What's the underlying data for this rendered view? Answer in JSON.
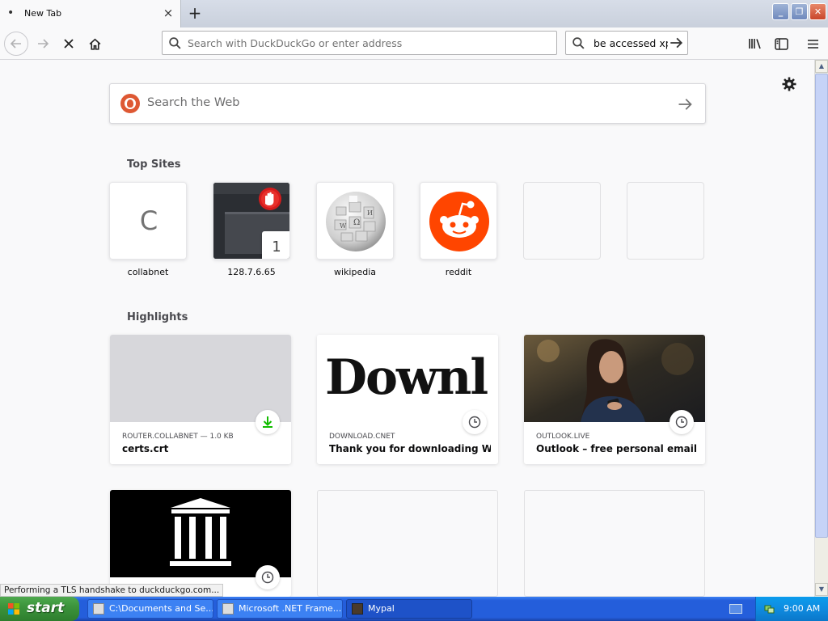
{
  "tab": {
    "title": "New Tab",
    "close_glyph": "×",
    "new_glyph": "+"
  },
  "window_controls": {
    "minimize": "_",
    "maximize": "❐",
    "close": "✕"
  },
  "navbar": {
    "url_placeholder": "Search with DuckDuckGo or enter address",
    "search_value": "be accessed xp"
  },
  "web_search": {
    "placeholder": "Search the Web"
  },
  "top_sites": {
    "title": "Top Sites",
    "items": [
      {
        "label": "collabnet",
        "letter": "C"
      },
      {
        "label": "128.7.6.65",
        "badge": "1"
      },
      {
        "label": "wikipedia"
      },
      {
        "label": "reddit"
      },
      {
        "label": ""
      },
      {
        "label": ""
      }
    ]
  },
  "highlights": {
    "title": "Highlights",
    "cards": [
      {
        "host": "ROUTER.COLLABNET — 1.0 KB",
        "title": "certs.crt",
        "badge": "download-icon"
      },
      {
        "host": "DOWNLOAD.CNET",
        "title": "Thank you for downloading Win...",
        "thumb_text": "Downl",
        "badge": "clock-icon"
      },
      {
        "host": "OUTLOOK.LIVE",
        "title": "Outlook – free personal email an...",
        "badge": "clock-icon"
      },
      {
        "host": "",
        "title": "",
        "badge": "clock-icon"
      }
    ]
  },
  "status": "Performing a TLS handshake to duckduckgo.com...",
  "taskbar": {
    "start": "start",
    "tasks": [
      "C:\\Documents and Se...",
      "Microsoft .NET Frame...",
      "Mypal"
    ],
    "clock": "9:00 AM"
  },
  "colors": {
    "reddit": "#ff4500",
    "ddg": "#de5833",
    "xp_blue": "#245edb",
    "start_green": "#3c943c",
    "download_green": "#12bc00"
  }
}
